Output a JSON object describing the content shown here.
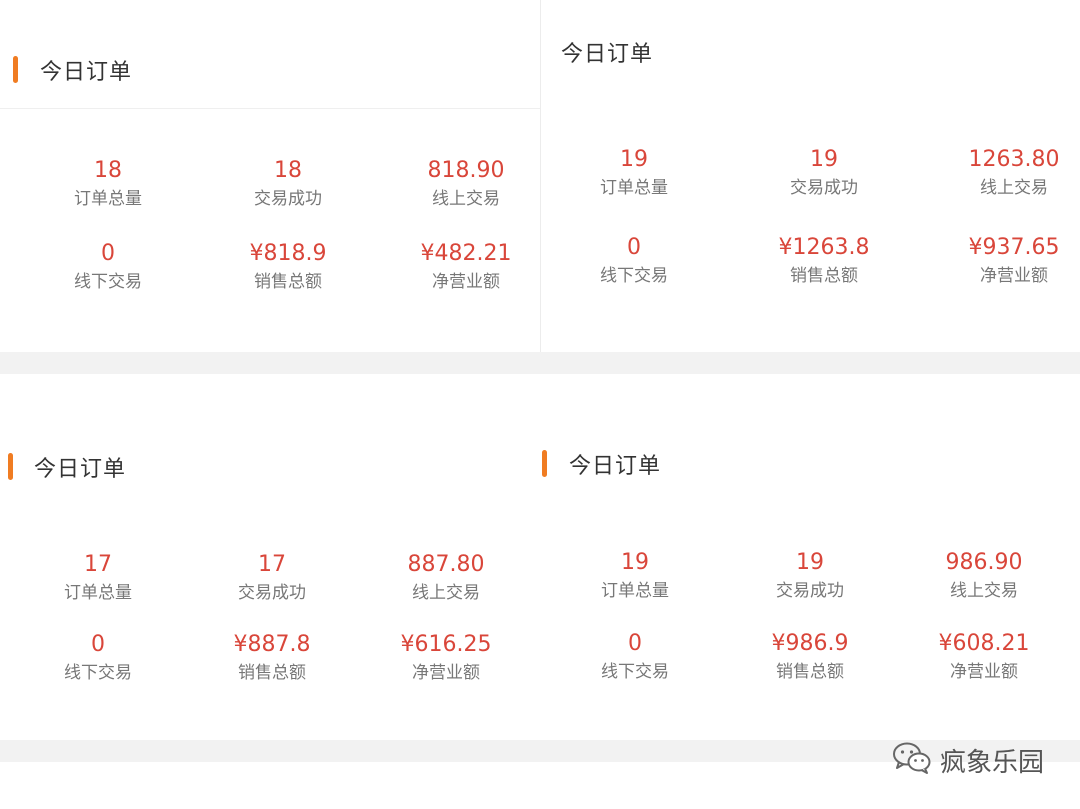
{
  "panels": [
    {
      "title": "今日订单",
      "stats": [
        {
          "value": "18",
          "label": "订单总量"
        },
        {
          "value": "18",
          "label": "交易成功"
        },
        {
          "value": "818.90",
          "label": "线上交易"
        },
        {
          "value": "0",
          "label": "线下交易"
        },
        {
          "value": "¥818.9",
          "label": "销售总额"
        },
        {
          "value": "¥482.21",
          "label": "净营业额"
        }
      ]
    },
    {
      "title": "今日订单",
      "stats": [
        {
          "value": "19",
          "label": "订单总量"
        },
        {
          "value": "19",
          "label": "交易成功"
        },
        {
          "value": "1263.80",
          "label": "线上交易"
        },
        {
          "value": "0",
          "label": "线下交易"
        },
        {
          "value": "¥1263.8",
          "label": "销售总额"
        },
        {
          "value": "¥937.65",
          "label": "净营业额"
        }
      ]
    },
    {
      "title": "今日订单",
      "stats": [
        {
          "value": "17",
          "label": "订单总量"
        },
        {
          "value": "17",
          "label": "交易成功"
        },
        {
          "value": "887.80",
          "label": "线上交易"
        },
        {
          "value": "0",
          "label": "线下交易"
        },
        {
          "value": "¥887.8",
          "label": "销售总额"
        },
        {
          "value": "¥616.25",
          "label": "净营业额"
        }
      ]
    },
    {
      "title": "今日订单",
      "stats": [
        {
          "value": "19",
          "label": "订单总量"
        },
        {
          "value": "19",
          "label": "交易成功"
        },
        {
          "value": "986.90",
          "label": "线上交易"
        },
        {
          "value": "0",
          "label": "线下交易"
        },
        {
          "value": "¥986.9",
          "label": "销售总额"
        },
        {
          "value": "¥608.21",
          "label": "净营业额"
        }
      ]
    }
  ],
  "watermark": {
    "icon": "wechat-icon",
    "text": "疯象乐园"
  },
  "colors": {
    "accent": "#f07c22",
    "value": "#d9463a",
    "label": "#777777",
    "title": "#333333",
    "gap": "#f2f2f2"
  }
}
